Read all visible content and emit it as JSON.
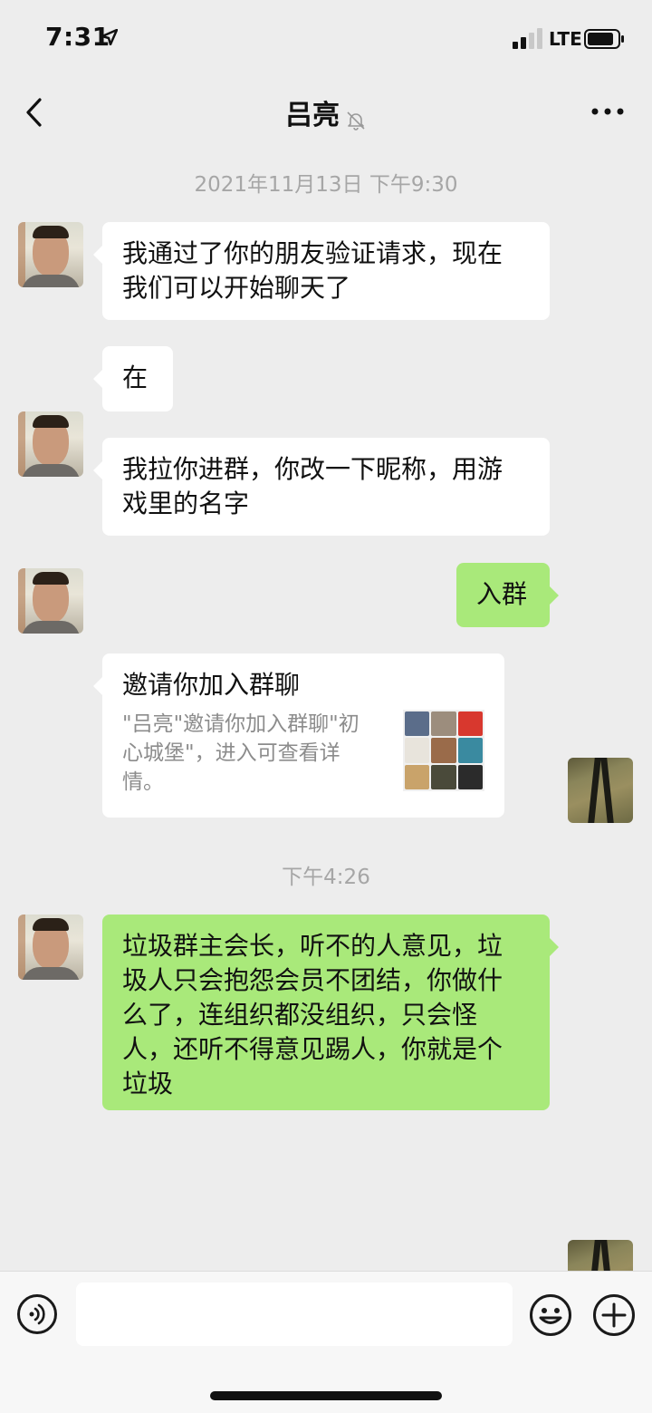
{
  "status_bar": {
    "time": "7:31",
    "carrier": "LTE",
    "icons": [
      "location-arrow-icon",
      "signal-bars-icon",
      "battery-icon"
    ]
  },
  "nav": {
    "title": "吕亮",
    "icons": [
      "back-chevron-icon",
      "muted-bell-icon",
      "more-dots-icon"
    ]
  },
  "timestamps": {
    "first": "2021年11月13日 下午9:30",
    "second": "下午4:26"
  },
  "messages": [
    {
      "sender": "other",
      "lines": [
        "我通过了你的朋友验证请求，现在",
        "我们可以开始聊天了"
      ]
    },
    {
      "sender": "other",
      "lines": [
        "在"
      ]
    },
    {
      "sender": "other",
      "lines": [
        "我拉你进群，你改一下昵称，用游",
        "戏里的名字"
      ]
    },
    {
      "sender": "me",
      "lines": [
        "入群"
      ]
    },
    {
      "sender": "other",
      "type": "group_invite",
      "title": "邀请你加入群聊",
      "desc_lines": [
        "\"吕亮\"邀请你加入群聊\"初",
        "心城堡\"，进入可查看详",
        "情。"
      ],
      "thumb_colors": [
        "#5b6d8a",
        "#9c8d7d",
        "#d8382e",
        "#e8e4dc",
        "#9a6b4a",
        "#3a8aa0",
        "#c9a36a",
        "#4a4a3a",
        "#2b2b2b"
      ]
    },
    {
      "sender": "me",
      "lines": [
        "垃圾群主会长，听不的人意见，垃",
        "圾人只会抱怨会员不团结，你做什",
        "么了，连组织都没组织，只会怪",
        "人，还听不得意见踢人，你就是个",
        "垃圾"
      ]
    }
  ],
  "input_bar": {
    "placeholder": "",
    "icons": [
      "voice-icon",
      "emoji-icon",
      "plus-icon"
    ]
  }
}
